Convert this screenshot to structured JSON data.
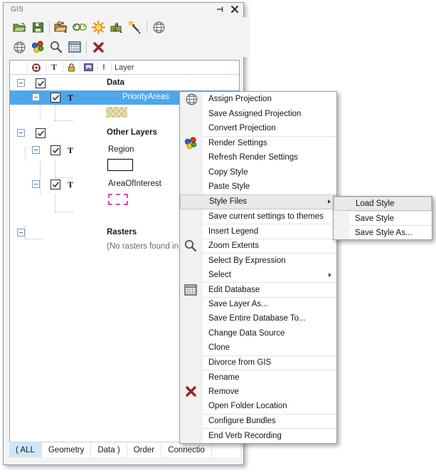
{
  "window": {
    "title": "GIS",
    "pin_icon": "pin-icon",
    "close_icon": "close-icon"
  },
  "toolbar_primary": [
    {
      "name": "open-folder-button",
      "icon": "open-folder-icon",
      "label": "Open"
    },
    {
      "name": "save-button",
      "icon": "floppy-save-icon",
      "label": "Save"
    },
    {
      "name": "add-geometry-button",
      "icon": "folder-g-plus-icon",
      "label": "Add Geometry"
    },
    {
      "name": "connection-button",
      "icon": "link-loop-icon",
      "label": "Connection"
    },
    {
      "name": "render-button",
      "icon": "sunburst-icon",
      "label": "Render"
    },
    {
      "name": "annotation-button",
      "icon": "label-a-icon",
      "label": "Annotation"
    },
    {
      "name": "select-wand-button",
      "icon": "magic-wand-icon",
      "label": "Select"
    },
    {
      "name": "projection-button",
      "icon": "globe-icon",
      "label": "Projection"
    }
  ],
  "toolbar_secondary": [
    {
      "name": "globe-button",
      "icon": "globe-icon",
      "label": "Projection"
    },
    {
      "name": "render-settings-button",
      "icon": "color-spheres-icon",
      "label": "Render Settings"
    },
    {
      "name": "zoom-button",
      "icon": "magnifier-icon",
      "label": "Zoom Extents"
    },
    {
      "name": "table-button",
      "icon": "grid-table-icon",
      "label": "Edit Database"
    },
    {
      "name": "remove-button",
      "icon": "red-x-icon",
      "label": "Remove"
    }
  ],
  "tree": {
    "columns": [
      {
        "name": "col-visibility",
        "icon": "target-circle-icon",
        "label": ""
      },
      {
        "name": "col-label",
        "icon": "text-t-icon",
        "label": "T"
      },
      {
        "name": "col-lock",
        "icon": "lock-icon",
        "label": ""
      },
      {
        "name": "col-database",
        "icon": "database-icon",
        "label": ""
      },
      {
        "name": "col-alert",
        "icon": "exclamation-icon",
        "label": "!"
      },
      {
        "name": "col-layer",
        "icon": "",
        "label": "Layer"
      }
    ],
    "nodes": [
      {
        "label": "Data",
        "type": "group",
        "checked": true,
        "expanded": true,
        "selected": false,
        "indent": 0,
        "has_t": false
      },
      {
        "label": "PriorityAreas",
        "type": "layer",
        "checked": true,
        "expanded": true,
        "selected": true,
        "indent": 1,
        "has_t": true,
        "swatch": "checker-tan"
      },
      {
        "label": "Other Layers",
        "type": "group",
        "checked": true,
        "expanded": true,
        "selected": false,
        "indent": 0,
        "has_t": false
      },
      {
        "label": "Region",
        "type": "layer",
        "checked": true,
        "expanded": true,
        "selected": false,
        "indent": 1,
        "has_t": true,
        "swatch": "white-rect"
      },
      {
        "label": "AreaOfInterest",
        "type": "layer",
        "checked": true,
        "expanded": true,
        "selected": false,
        "indent": 1,
        "has_t": true,
        "swatch": "magenta-dashed"
      },
      {
        "label": "Rasters",
        "type": "group",
        "checked": false,
        "expanded": true,
        "selected": false,
        "indent": 0,
        "has_t": false
      },
      {
        "label": "(No rasters found in sear",
        "type": "note",
        "checked": false,
        "expanded": false,
        "selected": false,
        "indent": 1,
        "has_t": false
      }
    ]
  },
  "tabs": [
    {
      "label": "( ALL",
      "active": true
    },
    {
      "label": "Geometry",
      "active": false
    },
    {
      "label": "Data )",
      "active": false
    },
    {
      "label": "Order",
      "active": false
    },
    {
      "label": "Connectio",
      "active": false
    }
  ],
  "context_menu": {
    "items": [
      {
        "label": "Assign Projection",
        "icon": "globe-icon",
        "separator": false,
        "submenu": false,
        "highlighted": false
      },
      {
        "label": "Save Assigned Projection",
        "icon": "",
        "separator": false,
        "submenu": false,
        "highlighted": false
      },
      {
        "label": "Convert Projection",
        "icon": "",
        "separator": false,
        "submenu": false,
        "highlighted": false
      },
      {
        "label": "Render Settings",
        "icon": "color-spheres-icon",
        "separator": true,
        "submenu": false,
        "highlighted": false
      },
      {
        "label": "Refresh Render Settings",
        "icon": "",
        "separator": false,
        "submenu": false,
        "highlighted": false
      },
      {
        "label": "Copy Style",
        "icon": "",
        "separator": false,
        "submenu": false,
        "highlighted": false
      },
      {
        "label": "Paste Style",
        "icon": "",
        "separator": false,
        "submenu": false,
        "highlighted": false
      },
      {
        "label": "Style Files",
        "icon": "",
        "separator": false,
        "submenu": true,
        "highlighted": true
      },
      {
        "label": "Save current settings to themes",
        "icon": "",
        "separator": false,
        "submenu": false,
        "highlighted": false
      },
      {
        "label": "Insert Legend",
        "icon": "",
        "separator": true,
        "submenu": false,
        "highlighted": false
      },
      {
        "label": "Zoom Extents",
        "icon": "magnifier-icon",
        "separator": true,
        "submenu": false,
        "highlighted": false
      },
      {
        "label": "Select By Expression",
        "icon": "",
        "separator": true,
        "submenu": false,
        "highlighted": false
      },
      {
        "label": "Select",
        "icon": "",
        "separator": false,
        "submenu": true,
        "highlighted": false
      },
      {
        "label": "Edit Database",
        "icon": "grid-table-icon",
        "separator": true,
        "submenu": false,
        "highlighted": false
      },
      {
        "label": "Save Layer As...",
        "icon": "",
        "separator": true,
        "submenu": false,
        "highlighted": false
      },
      {
        "label": "Save Entire Database To...",
        "icon": "",
        "separator": false,
        "submenu": false,
        "highlighted": false
      },
      {
        "label": "Change Data Source",
        "icon": "",
        "separator": false,
        "submenu": false,
        "highlighted": false
      },
      {
        "label": "Clone",
        "icon": "",
        "separator": false,
        "submenu": false,
        "highlighted": false
      },
      {
        "label": "Divorce from GIS",
        "icon": "",
        "separator": true,
        "submenu": false,
        "highlighted": false
      },
      {
        "label": "Rename",
        "icon": "",
        "separator": true,
        "submenu": false,
        "highlighted": false
      },
      {
        "label": "Remove",
        "icon": "red-x-icon",
        "separator": false,
        "submenu": false,
        "highlighted": false
      },
      {
        "label": "Open Folder Location",
        "icon": "",
        "separator": false,
        "submenu": false,
        "highlighted": false
      },
      {
        "label": "Configure Bundles",
        "icon": "",
        "separator": true,
        "submenu": false,
        "highlighted": false
      },
      {
        "label": "End Verb Recording",
        "icon": "",
        "separator": true,
        "submenu": false,
        "highlighted": false
      }
    ]
  },
  "sub_menu": {
    "items": [
      {
        "label": "Load Style",
        "highlighted": true
      },
      {
        "label": "Save Style",
        "highlighted": false,
        "separator": true
      },
      {
        "label": "Save Style As...",
        "highlighted": false,
        "separator": true
      }
    ]
  },
  "colors": {
    "selection_blue": "#4fa6e8",
    "tab_active": "#cfe6f7",
    "panel_bg": "#f3f3f3",
    "menu_bg": "#f1f1f1",
    "menu_highlight": "#e9e9e9"
  }
}
